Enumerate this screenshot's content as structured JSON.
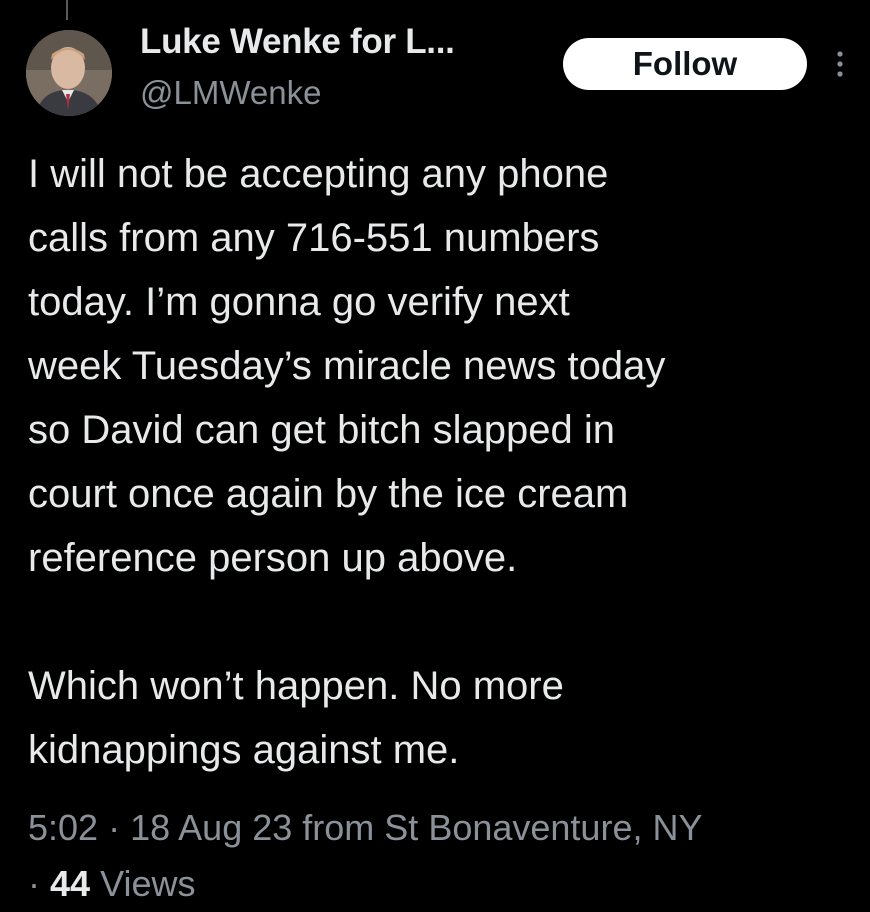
{
  "tweet": {
    "author": {
      "display_name": "Luke Wenke for L...",
      "handle": "@LMWenke",
      "avatar_icon": "profile-photo"
    },
    "follow_label": "Follow",
    "more_icon": "vertical-dots-icon",
    "paragraphs": [
      "I will not be accepting any phone\ncalls from any 716-551 numbers\ntoday.  I’m gonna go verify next\nweek Tuesday’s miracle news today\nso David can get bitch slapped in\ncourt once again by the ice cream\nreference person up above.",
      "Which won’t happen.  No more\nkidnappings against me."
    ],
    "meta": {
      "time": "5:02",
      "separator": "·",
      "date": "18 Aug 23",
      "location": "from St Bonaventure, NY",
      "views_count": "44",
      "views_label": "Views"
    }
  },
  "colors": {
    "background": "#000000",
    "primary_text": "#e7e9ea",
    "secondary_text": "#8b9199",
    "follow_bg": "#ffffff",
    "follow_text": "#0f1419"
  }
}
